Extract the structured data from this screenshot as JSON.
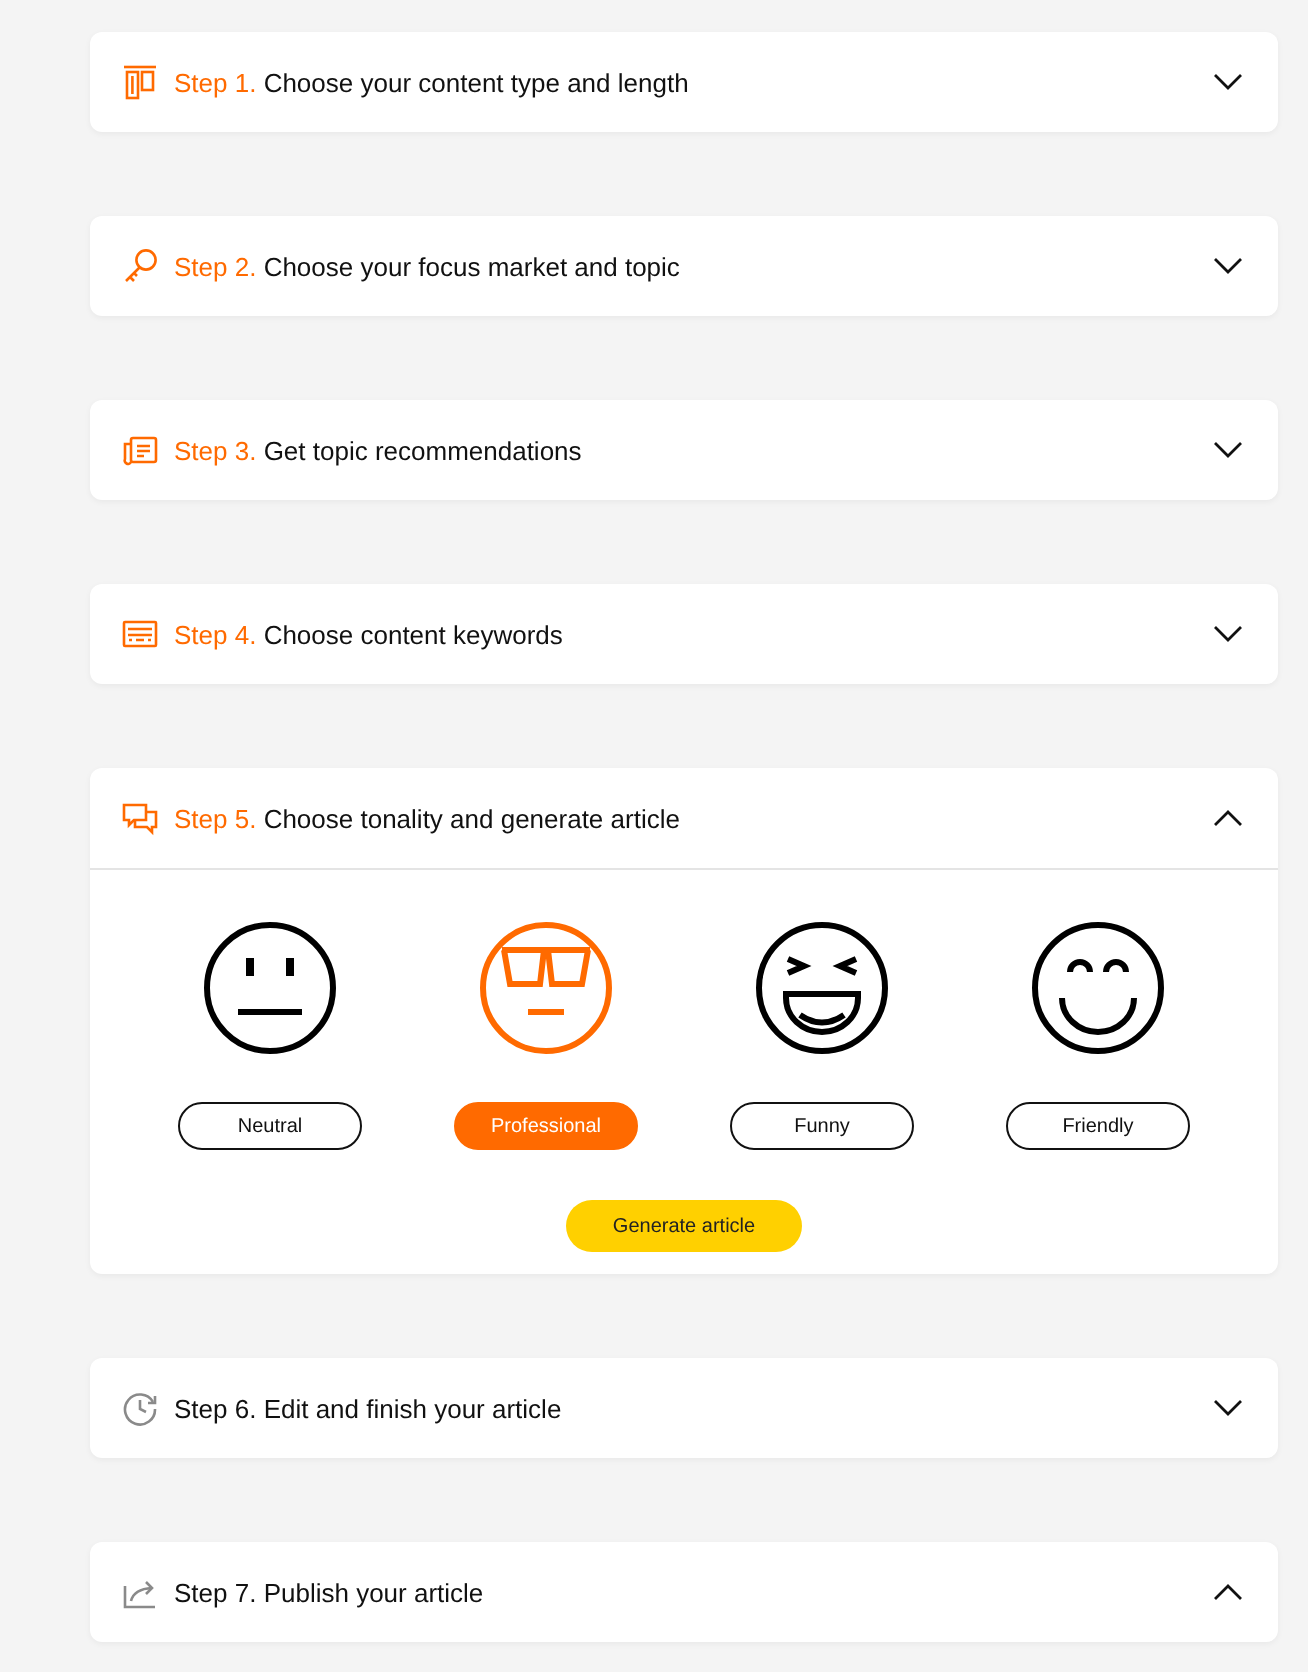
{
  "steps": [
    {
      "prefix": "Step 1.",
      "title": "Choose your content type and length",
      "active": true,
      "expanded": false
    },
    {
      "prefix": "Step 2.",
      "title": "Choose your focus market and topic",
      "active": true,
      "expanded": false
    },
    {
      "prefix": "Step 3.",
      "title": "Get topic recommendations",
      "active": true,
      "expanded": false
    },
    {
      "prefix": "Step 4.",
      "title": "Choose content keywords",
      "active": true,
      "expanded": false
    },
    {
      "prefix": "Step 5.",
      "title": "Choose tonality and generate article",
      "active": true,
      "expanded": true,
      "tonalities": [
        {
          "label": "Neutral",
          "selected": false
        },
        {
          "label": "Professional",
          "selected": true
        },
        {
          "label": "Funny",
          "selected": false
        },
        {
          "label": "Friendly",
          "selected": false
        }
      ],
      "action": "Generate article"
    },
    {
      "prefix": "Step 6.",
      "title": "Edit and finish your article",
      "active": false,
      "expanded": false
    },
    {
      "prefix": "Step 7.",
      "title": "Publish your article",
      "active": false,
      "expanded": true
    }
  ]
}
